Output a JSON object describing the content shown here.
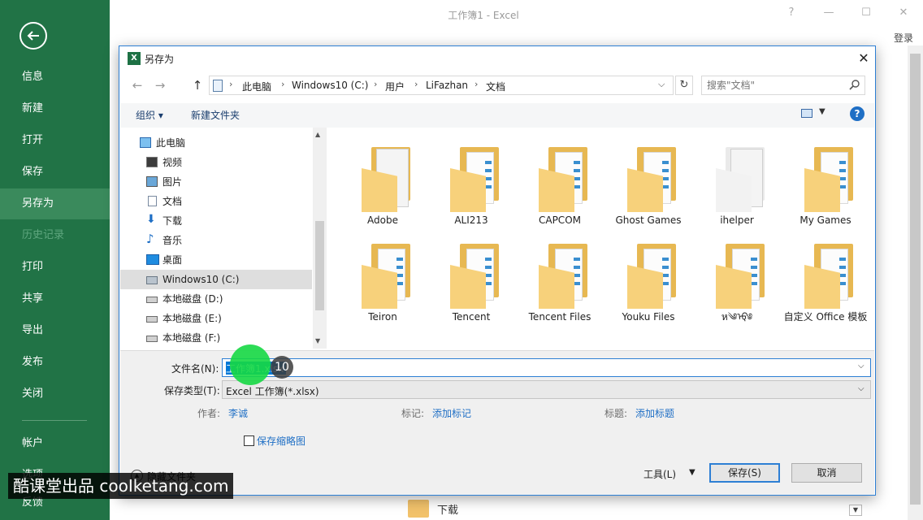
{
  "window": {
    "title": "工作簿1 - Excel",
    "controls": [
      "?",
      "—",
      "☐",
      "✕"
    ],
    "login": "登录"
  },
  "backstage": {
    "items": [
      {
        "label": "信息",
        "state": "normal"
      },
      {
        "label": "新建",
        "state": "normal"
      },
      {
        "label": "打开",
        "state": "normal"
      },
      {
        "label": "保存",
        "state": "normal"
      },
      {
        "label": "另存为",
        "state": "active"
      },
      {
        "label": "历史记录",
        "state": "disabled"
      },
      {
        "label": "打印",
        "state": "normal"
      },
      {
        "label": "共享",
        "state": "normal"
      },
      {
        "label": "导出",
        "state": "normal"
      },
      {
        "label": "发布",
        "state": "normal"
      },
      {
        "label": "关闭",
        "state": "normal"
      },
      {
        "label": "帐户",
        "state": "normal"
      },
      {
        "label": "选项",
        "state": "normal"
      },
      {
        "label": "反馈",
        "state": "normal"
      }
    ]
  },
  "background": {
    "folder_label": "下载"
  },
  "dialog": {
    "title": "另存为",
    "close": "✕",
    "breadcrumbs": [
      "此电脑",
      "Windows10 (C:)",
      "用户",
      "LiFazhan",
      "文档"
    ],
    "search_placeholder": "搜索\"文档\"",
    "toolbar": {
      "organize": "组织 ▾",
      "new_folder": "新建文件夹",
      "help": "?"
    },
    "nav_tree": [
      {
        "label": "此电脑",
        "icon": "computer-icon"
      },
      {
        "label": "视频",
        "icon": "video-icon"
      },
      {
        "label": "图片",
        "icon": "pictures-icon"
      },
      {
        "label": "文档",
        "icon": "documents-icon"
      },
      {
        "label": "下载",
        "icon": "download-icon"
      },
      {
        "label": "音乐",
        "icon": "music-icon"
      },
      {
        "label": "桌面",
        "icon": "desktop-icon"
      },
      {
        "label": "Windows10 (C:)",
        "icon": "drive-c-icon",
        "selected": true
      },
      {
        "label": "本地磁盘 (D:)",
        "icon": "drive-icon"
      },
      {
        "label": "本地磁盘 (E:)",
        "icon": "drive-icon"
      },
      {
        "label": "本地磁盘 (F:)",
        "icon": "drive-icon"
      }
    ],
    "folders": [
      {
        "name": "Adobe",
        "kind": "document"
      },
      {
        "name": "ALI213",
        "kind": "folder"
      },
      {
        "name": "CAPCOM",
        "kind": "folder"
      },
      {
        "name": "Ghost Games",
        "kind": "folder"
      },
      {
        "name": "ihelper",
        "kind": "document"
      },
      {
        "name": "My Games",
        "kind": "folder"
      },
      {
        "name": "Teiron",
        "kind": "folder"
      },
      {
        "name": "Tencent",
        "kind": "folder"
      },
      {
        "name": "Tencent Files",
        "kind": "folder"
      },
      {
        "name": "Youku Files",
        "kind": "folder"
      },
      {
        "name": "ห༄ᡇ༅",
        "kind": "folder"
      },
      {
        "name": "自定义 Office 模板",
        "kind": "folder"
      }
    ],
    "filename_label": "文件名(N):",
    "filename_value": "工作簿1.xlsx",
    "filetype_label": "保存类型(T):",
    "filetype_value": "Excel 工作簿(*.xlsx)",
    "meta": {
      "author_label": "作者:",
      "author_value": "李诚",
      "tags_label": "标记:",
      "tags_value": "添加标记",
      "title_label": "标题:",
      "title_value": "添加标题"
    },
    "save_thumbnail": "保存缩略图",
    "hide_folders": "隐藏文件夹",
    "tools": "工具(L)",
    "save": "保存(S)",
    "cancel": "取消"
  },
  "overlay": {
    "step": "10",
    "watermark": "酷课堂出品 cooIketang.com"
  },
  "colors": {
    "backstage_green": "#217346",
    "accent_blue": "#2d7fd4",
    "link_blue": "#1f6fc5",
    "folder_yellow": "#f7d17b",
    "cursor_green": "#16d844"
  }
}
